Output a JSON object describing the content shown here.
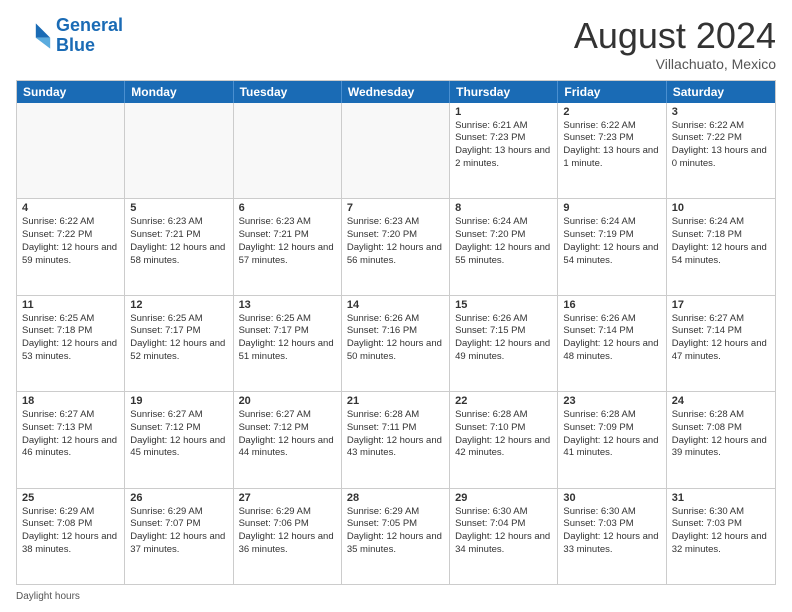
{
  "logo": {
    "line1": "General",
    "line2": "Blue"
  },
  "title": "August 2024",
  "location": "Villachuato, Mexico",
  "days_header": [
    "Sunday",
    "Monday",
    "Tuesday",
    "Wednesday",
    "Thursday",
    "Friday",
    "Saturday"
  ],
  "footer_label": "Daylight hours",
  "weeks": [
    [
      {
        "day": "",
        "info": ""
      },
      {
        "day": "",
        "info": ""
      },
      {
        "day": "",
        "info": ""
      },
      {
        "day": "",
        "info": ""
      },
      {
        "day": "1",
        "info": "Sunrise: 6:21 AM\nSunset: 7:23 PM\nDaylight: 13 hours and 2 minutes."
      },
      {
        "day": "2",
        "info": "Sunrise: 6:22 AM\nSunset: 7:23 PM\nDaylight: 13 hours and 1 minute."
      },
      {
        "day": "3",
        "info": "Sunrise: 6:22 AM\nSunset: 7:22 PM\nDaylight: 13 hours and 0 minutes."
      }
    ],
    [
      {
        "day": "4",
        "info": "Sunrise: 6:22 AM\nSunset: 7:22 PM\nDaylight: 12 hours and 59 minutes."
      },
      {
        "day": "5",
        "info": "Sunrise: 6:23 AM\nSunset: 7:21 PM\nDaylight: 12 hours and 58 minutes."
      },
      {
        "day": "6",
        "info": "Sunrise: 6:23 AM\nSunset: 7:21 PM\nDaylight: 12 hours and 57 minutes."
      },
      {
        "day": "7",
        "info": "Sunrise: 6:23 AM\nSunset: 7:20 PM\nDaylight: 12 hours and 56 minutes."
      },
      {
        "day": "8",
        "info": "Sunrise: 6:24 AM\nSunset: 7:20 PM\nDaylight: 12 hours and 55 minutes."
      },
      {
        "day": "9",
        "info": "Sunrise: 6:24 AM\nSunset: 7:19 PM\nDaylight: 12 hours and 54 minutes."
      },
      {
        "day": "10",
        "info": "Sunrise: 6:24 AM\nSunset: 7:18 PM\nDaylight: 12 hours and 54 minutes."
      }
    ],
    [
      {
        "day": "11",
        "info": "Sunrise: 6:25 AM\nSunset: 7:18 PM\nDaylight: 12 hours and 53 minutes."
      },
      {
        "day": "12",
        "info": "Sunrise: 6:25 AM\nSunset: 7:17 PM\nDaylight: 12 hours and 52 minutes."
      },
      {
        "day": "13",
        "info": "Sunrise: 6:25 AM\nSunset: 7:17 PM\nDaylight: 12 hours and 51 minutes."
      },
      {
        "day": "14",
        "info": "Sunrise: 6:26 AM\nSunset: 7:16 PM\nDaylight: 12 hours and 50 minutes."
      },
      {
        "day": "15",
        "info": "Sunrise: 6:26 AM\nSunset: 7:15 PM\nDaylight: 12 hours and 49 minutes."
      },
      {
        "day": "16",
        "info": "Sunrise: 6:26 AM\nSunset: 7:14 PM\nDaylight: 12 hours and 48 minutes."
      },
      {
        "day": "17",
        "info": "Sunrise: 6:27 AM\nSunset: 7:14 PM\nDaylight: 12 hours and 47 minutes."
      }
    ],
    [
      {
        "day": "18",
        "info": "Sunrise: 6:27 AM\nSunset: 7:13 PM\nDaylight: 12 hours and 46 minutes."
      },
      {
        "day": "19",
        "info": "Sunrise: 6:27 AM\nSunset: 7:12 PM\nDaylight: 12 hours and 45 minutes."
      },
      {
        "day": "20",
        "info": "Sunrise: 6:27 AM\nSunset: 7:12 PM\nDaylight: 12 hours and 44 minutes."
      },
      {
        "day": "21",
        "info": "Sunrise: 6:28 AM\nSunset: 7:11 PM\nDaylight: 12 hours and 43 minutes."
      },
      {
        "day": "22",
        "info": "Sunrise: 6:28 AM\nSunset: 7:10 PM\nDaylight: 12 hours and 42 minutes."
      },
      {
        "day": "23",
        "info": "Sunrise: 6:28 AM\nSunset: 7:09 PM\nDaylight: 12 hours and 41 minutes."
      },
      {
        "day": "24",
        "info": "Sunrise: 6:28 AM\nSunset: 7:08 PM\nDaylight: 12 hours and 39 minutes."
      }
    ],
    [
      {
        "day": "25",
        "info": "Sunrise: 6:29 AM\nSunset: 7:08 PM\nDaylight: 12 hours and 38 minutes."
      },
      {
        "day": "26",
        "info": "Sunrise: 6:29 AM\nSunset: 7:07 PM\nDaylight: 12 hours and 37 minutes."
      },
      {
        "day": "27",
        "info": "Sunrise: 6:29 AM\nSunset: 7:06 PM\nDaylight: 12 hours and 36 minutes."
      },
      {
        "day": "28",
        "info": "Sunrise: 6:29 AM\nSunset: 7:05 PM\nDaylight: 12 hours and 35 minutes."
      },
      {
        "day": "29",
        "info": "Sunrise: 6:30 AM\nSunset: 7:04 PM\nDaylight: 12 hours and 34 minutes."
      },
      {
        "day": "30",
        "info": "Sunrise: 6:30 AM\nSunset: 7:03 PM\nDaylight: 12 hours and 33 minutes."
      },
      {
        "day": "31",
        "info": "Sunrise: 6:30 AM\nSunset: 7:03 PM\nDaylight: 12 hours and 32 minutes."
      }
    ]
  ]
}
